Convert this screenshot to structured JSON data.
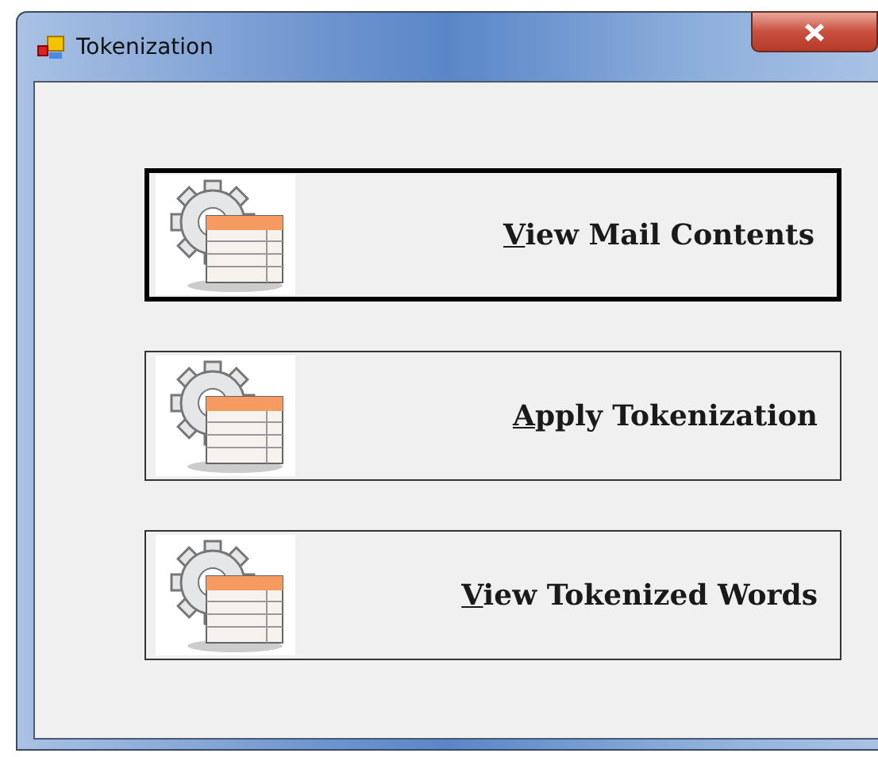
{
  "window": {
    "title": "Tokenization"
  },
  "buttons": [
    {
      "label": "View Mail Contents",
      "focused": true
    },
    {
      "label": "Apply Tokenization",
      "focused": false
    },
    {
      "label": "View Tokenized Words",
      "focused": false
    }
  ]
}
